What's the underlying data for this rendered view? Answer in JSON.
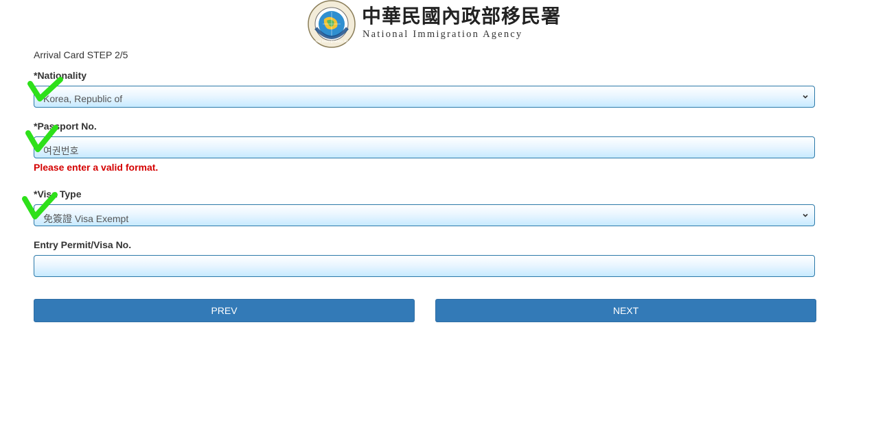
{
  "header": {
    "agency_name_zh": "中華民國內政部移民署",
    "agency_name_en": "National Immigration Agency",
    "seal_text": "National Immigration Agency"
  },
  "form": {
    "step_title": "Arrival Card STEP 2/5",
    "nationality": {
      "label": "*Nationality",
      "value": "Korea, Republic of"
    },
    "passport": {
      "label": "*Passport No.",
      "value": "여권번호",
      "error": "Please enter a valid format."
    },
    "visa_type": {
      "label": "*Visa Type",
      "value": "免簽證 Visa Exempt"
    },
    "entry_permit": {
      "label": "Entry Permit/Visa No.",
      "value": ""
    }
  },
  "buttons": {
    "prev_label": "PREV",
    "next_label": "NEXT"
  },
  "colors": {
    "button_bg": "#337ab7",
    "error": "#d40000",
    "field_border": "#2a78a8",
    "checkmark": "#2ee01a"
  },
  "icons": {
    "logo": "agency-seal-icon",
    "select_arrow": "chevron-down-icon",
    "annotation": "checkmark-icon"
  }
}
